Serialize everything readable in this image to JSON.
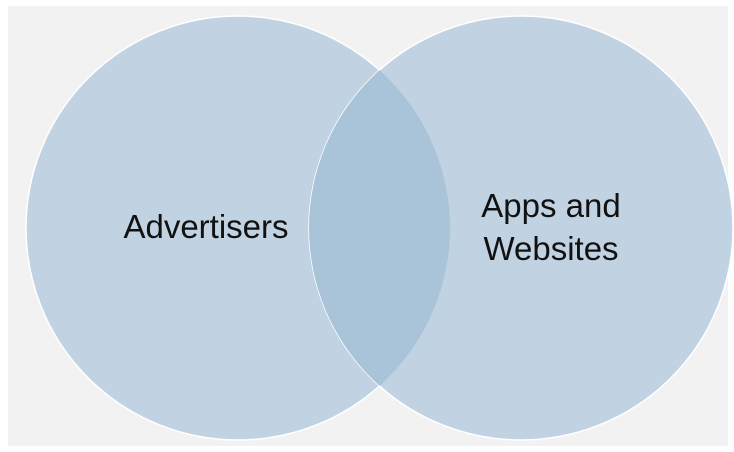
{
  "diagram": {
    "type": "venn",
    "sets": [
      {
        "label_lines": [
          "Advertisers"
        ]
      },
      {
        "label_lines": [
          "Apps and",
          "Websites"
        ]
      }
    ]
  },
  "colors": {
    "background": "#f2f2f2",
    "circle_fill": "#c1d2e2",
    "circle_stroke": "#ffffff",
    "overlap_fill": "#a9c3d8",
    "text": "#111111"
  }
}
